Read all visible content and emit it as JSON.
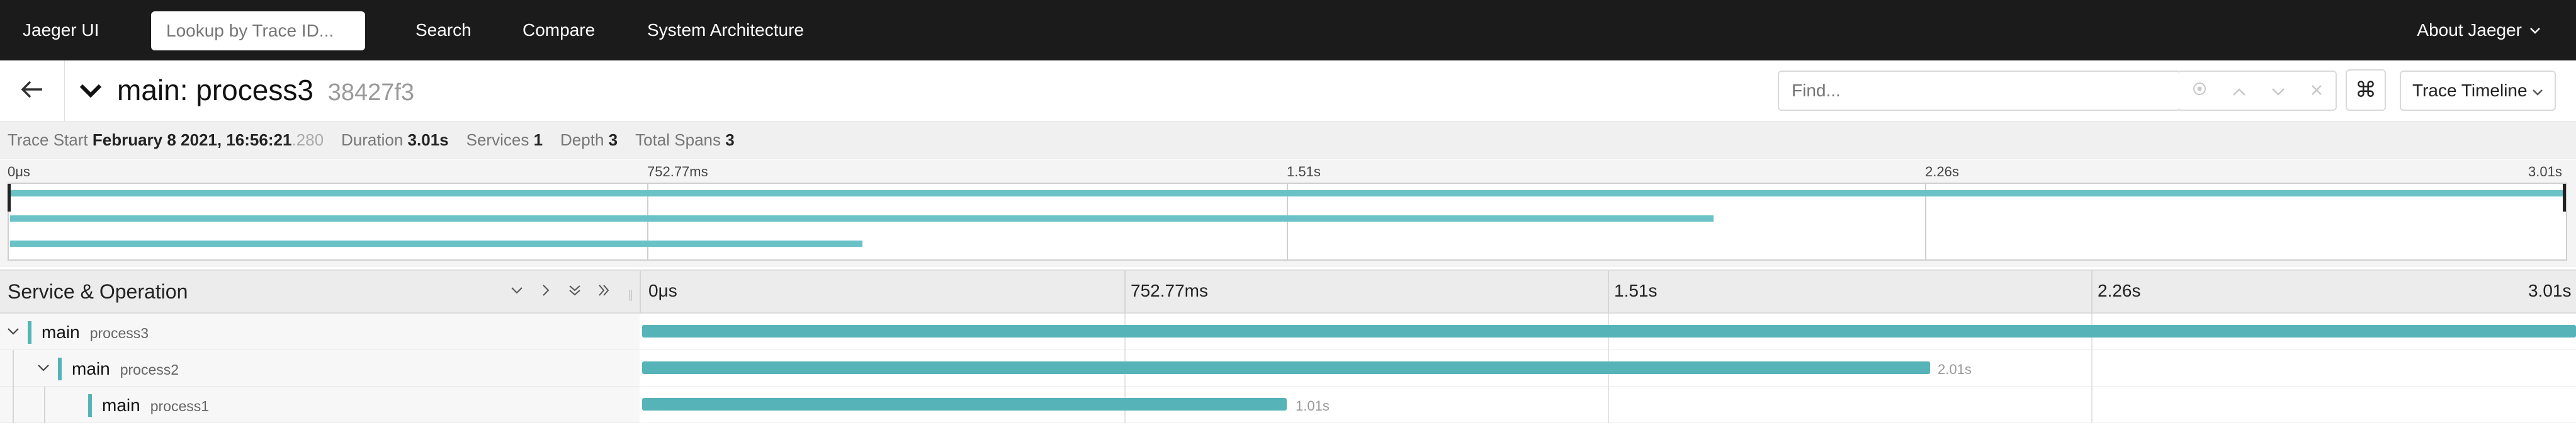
{
  "nav": {
    "brand": "Jaeger UI",
    "lookup_placeholder": "Lookup by Trace ID...",
    "links": [
      "Search",
      "Compare",
      "System Architecture"
    ],
    "about": "About Jaeger"
  },
  "trace": {
    "title": "main: process3",
    "trace_id": "38427f3",
    "find_placeholder": "Find...",
    "view_mode": "Trace Timeline"
  },
  "summary": {
    "start_label": "Trace Start",
    "start_value": "February 8 2021, 16:56:21",
    "start_ms": ".280",
    "duration_label": "Duration",
    "duration_value": "3.01s",
    "services_label": "Services",
    "services_value": "1",
    "depth_label": "Depth",
    "depth_value": "3",
    "total_spans_label": "Total Spans",
    "total_spans_value": "3"
  },
  "minimap": {
    "ticks": [
      "0μs",
      "752.77ms",
      "1.51s",
      "2.26s",
      "3.01s"
    ]
  },
  "timeline": {
    "column_title": "Service & Operation",
    "ticks": [
      "0μs",
      "752.77ms",
      "1.51s",
      "2.26s",
      "3.01s"
    ]
  },
  "spans": [
    {
      "service": "main",
      "operation": "process3",
      "duration": ""
    },
    {
      "service": "main",
      "operation": "process2",
      "duration": "2.01s"
    },
    {
      "service": "main",
      "operation": "process1",
      "duration": "1.01s"
    }
  ],
  "colors": {
    "nav_bg": "#1b1b1b",
    "span_bar": "#56b3b8",
    "minimap_bar": "#6bc2c6"
  }
}
